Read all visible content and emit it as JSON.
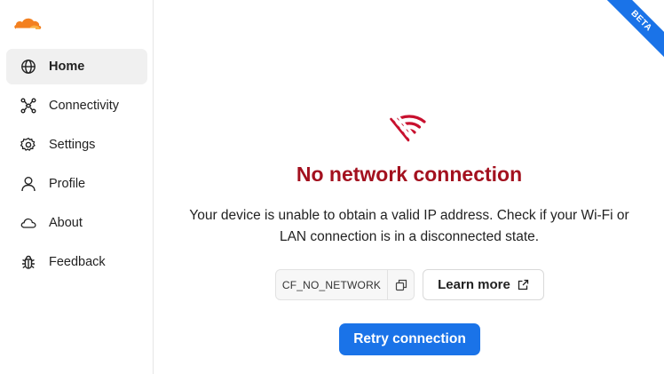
{
  "sidebar": {
    "items": [
      {
        "label": "Home",
        "icon": "globe-icon",
        "active": true
      },
      {
        "label": "Connectivity",
        "icon": "network-icon"
      },
      {
        "label": "Settings",
        "icon": "gear-icon"
      },
      {
        "label": "Profile",
        "icon": "user-icon"
      },
      {
        "label": "About",
        "icon": "cloud-icon"
      },
      {
        "label": "Feedback",
        "icon": "bug-icon"
      }
    ]
  },
  "ribbon": {
    "label": "BETA"
  },
  "main": {
    "status_icon": "wifi-off-icon",
    "title": "No network connection",
    "description": "Your device is unable to obtain a valid IP address. Check if your Wi-Fi or LAN connection is in a disconnected state.",
    "error_code": "CF_NO_NETWORK",
    "learn_more_label": "Learn more",
    "retry_label": "Retry connection"
  },
  "colors": {
    "brand_orange": "#f38020",
    "error_red": "#a3111f",
    "accent_blue": "#1a73e8"
  }
}
